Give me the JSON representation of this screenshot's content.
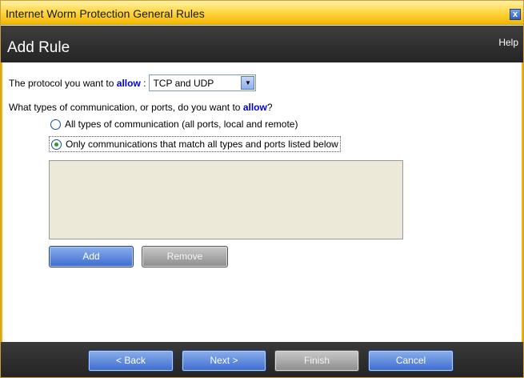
{
  "window": {
    "title": "Internet Worm Protection General Rules",
    "close_glyph": "x"
  },
  "header": {
    "heading": "Add Rule",
    "help_label": "Help"
  },
  "protocol": {
    "prefix": "The protocol you want to",
    "keyword": "allow",
    "colon": ":",
    "selected_value": "TCP and UDP",
    "arrow_glyph": "▼"
  },
  "types_question": {
    "prefix": "What types of communication, or ports, do you want to",
    "keyword": "allow",
    "suffix": "?"
  },
  "options": {
    "all_types": {
      "label": "All types of communication (all ports, local and remote)",
      "selected": false
    },
    "matching_only": {
      "label": "Only communications that match all types and ports listed below",
      "selected": true
    }
  },
  "list_actions": {
    "add_label": "Add",
    "remove_label": "Remove"
  },
  "footer": {
    "back_label": "< Back",
    "next_label": "Next >",
    "finish_label": "Finish",
    "cancel_label": "Cancel"
  },
  "colors": {
    "title_bar": "#ffd84a",
    "header_bg": "#2f2f2f",
    "keyword": "#0000cc",
    "button_blue": "#3d6bd1",
    "button_disabled": "#8c8c8c",
    "list_bg": "#ece9d8"
  }
}
